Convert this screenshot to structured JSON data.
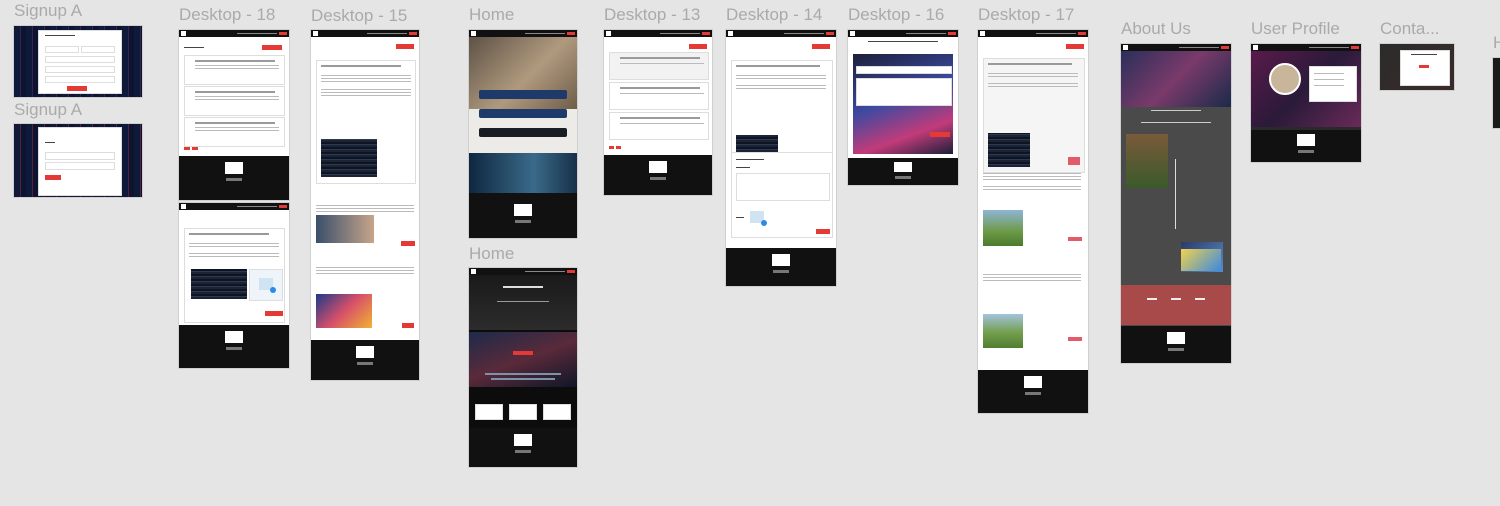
{
  "canvas": {
    "background": "#e5e5e5",
    "label_color": "#aaaaaa",
    "accent": "#e53935"
  },
  "frames": {
    "signup_a_1": "Signup A",
    "signup_a_2": "Signup A",
    "desktop_18": "Desktop - 18",
    "desktop_15": "Desktop - 15",
    "home_1": "Home",
    "desktop_13": "Desktop - 13",
    "desktop_14": "Desktop - 14",
    "desktop_16": "Desktop - 16",
    "desktop_17": "Desktop - 17",
    "about_us": "About Us",
    "user_profile": "User Profile",
    "contact": "Conta...",
    "home_2": "Home"
  },
  "icons": {
    "upload": "upload-image-icon",
    "social": "social-icons",
    "logo": "logo-icon"
  }
}
